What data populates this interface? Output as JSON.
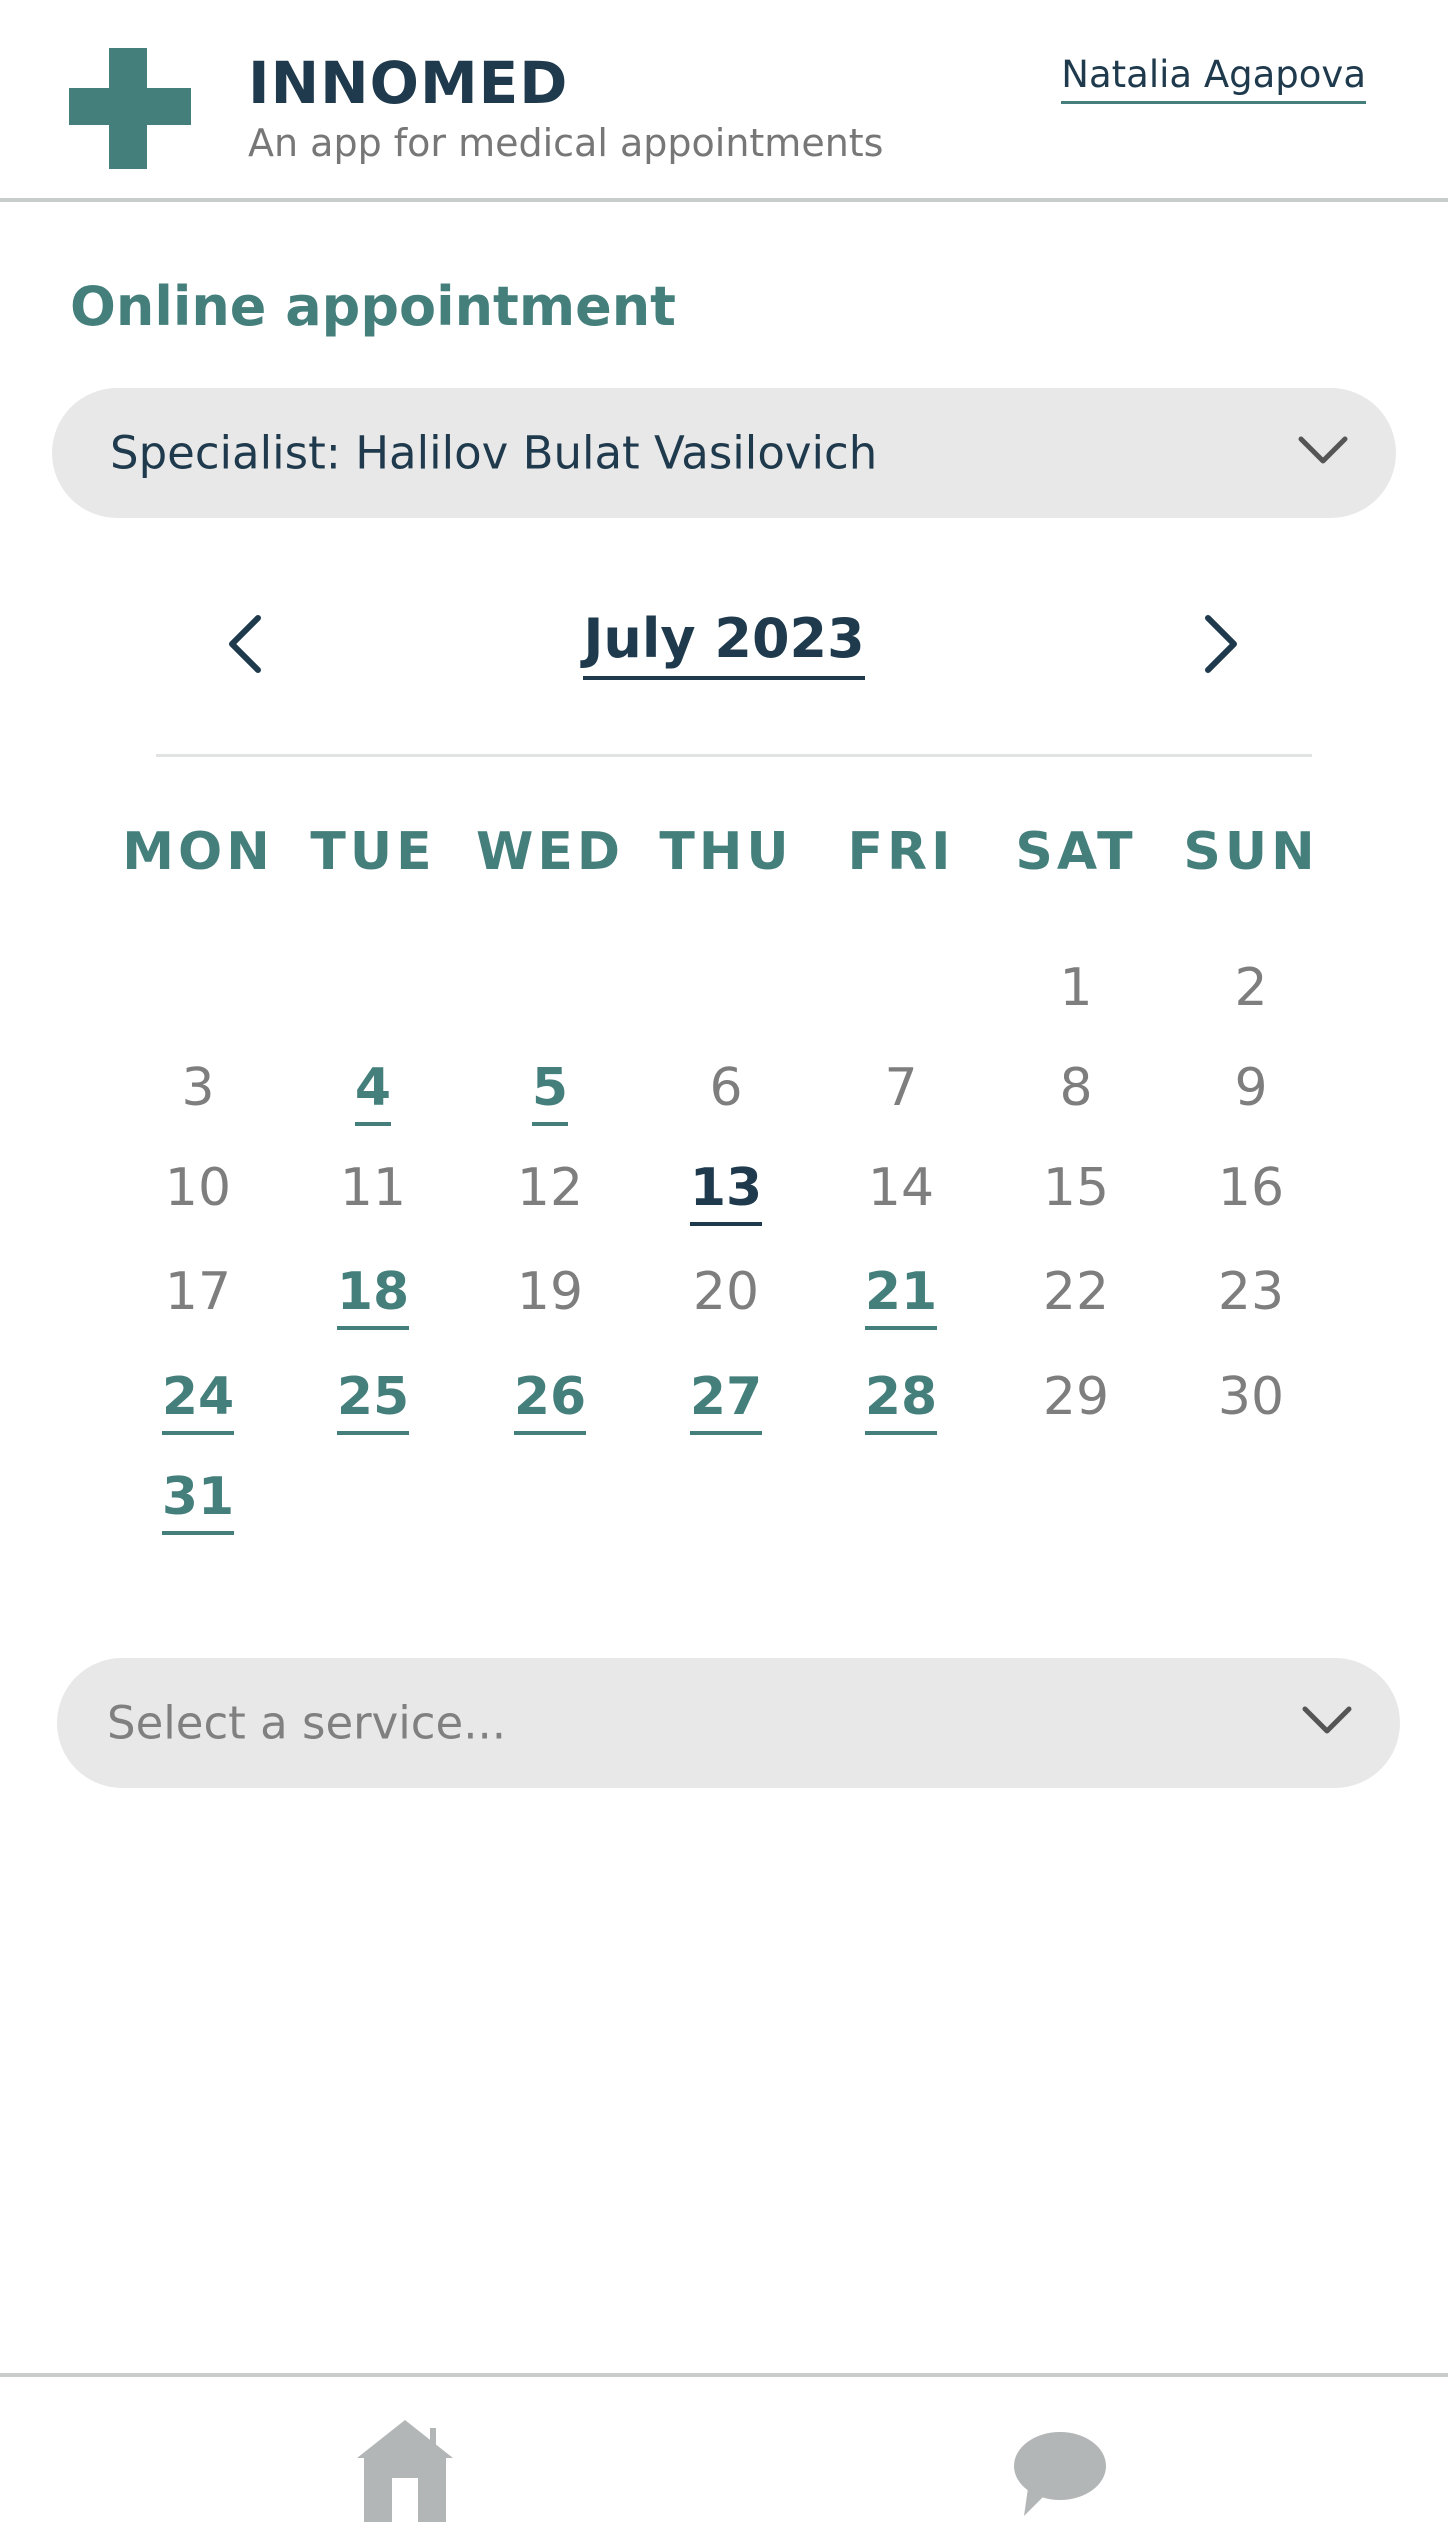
{
  "header": {
    "app_name": "INNOMED",
    "tagline": "An app for medical appointments",
    "user_name": "Natalia Agapova",
    "logo_icon": "medical-cross-icon"
  },
  "section_title": "Online appointment",
  "specialist_dropdown": {
    "value": "Specialist: Halilov Bulat Vasilovich"
  },
  "calendar": {
    "month_label": "July 2023",
    "weekdays": [
      "MON",
      "TUE",
      "WED",
      "THU",
      "FRI",
      "SAT",
      "SUN"
    ],
    "weeks": [
      [
        null,
        null,
        null,
        null,
        null,
        1,
        2
      ],
      [
        3,
        4,
        5,
        6,
        7,
        8,
        9
      ],
      [
        10,
        11,
        12,
        13,
        14,
        15,
        16
      ],
      [
        17,
        18,
        19,
        20,
        21,
        22,
        23
      ],
      [
        24,
        25,
        26,
        27,
        28,
        29,
        30
      ],
      [
        31,
        null,
        null,
        null,
        null,
        null,
        null
      ]
    ],
    "available_days": [
      4,
      5,
      18,
      21,
      24,
      25,
      26,
      27,
      28,
      31
    ],
    "today": 13
  },
  "service_dropdown": {
    "placeholder": "Select a service..."
  },
  "bottom_nav": {
    "items": [
      "home-icon",
      "chat-icon"
    ]
  },
  "colors": {
    "accent": "#447f7c",
    "dark": "#1f3a4d",
    "muted": "#7e7e7e",
    "field_bg": "#e8e8e8",
    "icon_gray": "#b3b6b6"
  }
}
